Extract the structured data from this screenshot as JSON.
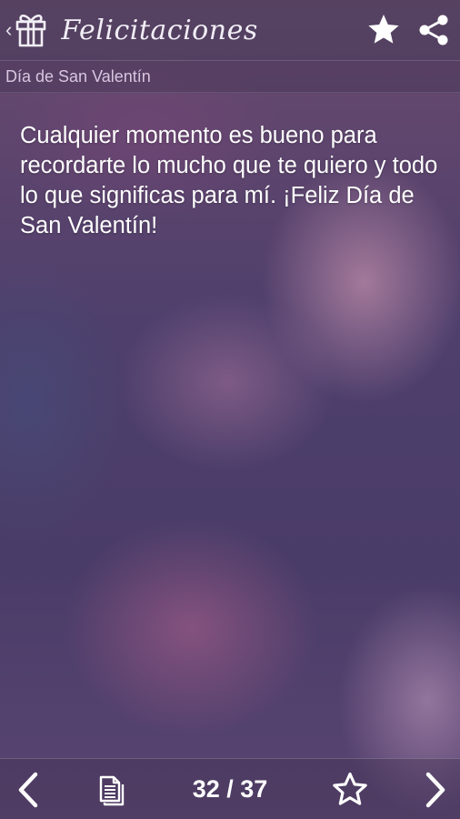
{
  "header": {
    "title": "Felicitaciones",
    "icons": {
      "up": "chevron-left-icon",
      "app": "gift-icon",
      "favorite": "star-icon",
      "share": "share-icon"
    }
  },
  "category": "Día de San Valentín",
  "message": "Cualquier momento es bueno para recordarte lo mucho que te quiero y todo lo que significas para mí. ¡Feliz Día de San Valentín!",
  "navigation": {
    "counter": "32 / 37",
    "icons": {
      "previous": "chevron-left-icon",
      "copy": "copy-icon",
      "favorite": "star-outline-icon",
      "next": "chevron-right-icon"
    }
  },
  "colors": {
    "text": "#ffffff",
    "category_text": "#d8c6e0",
    "icon": "#ffffff"
  }
}
